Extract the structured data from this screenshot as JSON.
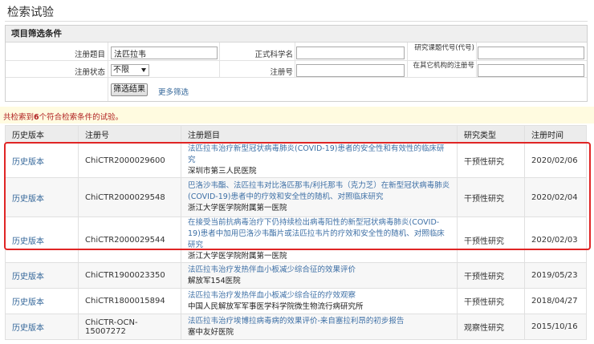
{
  "page": {
    "title": "检索试验"
  },
  "filter": {
    "header": "项目筛选条件",
    "reg_title_label": "注册题目",
    "reg_title_value": "法匹拉韦",
    "sci_name_label": "正式科学名",
    "sci_name_value": "",
    "topic_code_label": "研究课题代号(代号)",
    "topic_code_value": "",
    "status_label": "注册状态",
    "status_value": "不限",
    "reg_no_label": "注册号",
    "reg_no_value": "",
    "other_reg_label": "在其它机构的注册号",
    "other_reg_value": "",
    "submit_label": "筛选结果",
    "more_label": "更多筛选"
  },
  "results": {
    "prefix": "共检索到",
    "count": "6",
    "suffix": "个符合检索条件的试验。"
  },
  "table": {
    "headers": {
      "history": "历史版本",
      "reg_no": "注册号",
      "title": "注册题目",
      "type": "研究类型",
      "time": "注册时间"
    },
    "rows": [
      {
        "history": "历史版本",
        "reg_no": "ChiCTR2000029600",
        "title": "法匹拉韦治疗新型冠状病毒肺炎(COVID-19)患者的安全性和有效性的临床研究",
        "inst": "深圳市第三人民医院",
        "type": "干预性研究",
        "date": "2020/02/06"
      },
      {
        "history": "历史版本",
        "reg_no": "ChiCTR2000029548",
        "title": "巴洛沙韦酯、法匹拉韦对比洛匹那韦/利托那韦（克力芝）在新型冠状病毒肺炎(COVID-19)患者中的疗效和安全性的随机、对照临床研究",
        "inst": "浙江大学医学院附属第一医院",
        "type": "干预性研究",
        "date": "2020/02/04"
      },
      {
        "history": "历史版本",
        "reg_no": "ChiCTR2000029544",
        "title": "在接受当前抗病毒治疗下仍持续检出病毒阳性的新型冠状病毒肺炎(COVID-19)患者中加用巴洛沙韦酯片或法匹拉韦片的疗效和安全性的随机、对照临床研究",
        "inst": "浙江大学医学院附属第一医院",
        "type": "干预性研究",
        "date": "2020/02/03"
      },
      {
        "history": "历史版本",
        "reg_no": "ChiCTR1900023350",
        "title": "法匹拉韦治疗发热伴血小板减少综合征的效果评价",
        "inst": "解放军154医院",
        "type": "干预性研究",
        "date": "2019/05/23"
      },
      {
        "history": "历史版本",
        "reg_no": "ChiCTR1800015894",
        "title": "法匹拉韦治疗发热伴血小板减少综合征的疗效观察",
        "inst": "中国人民解放军军事医学科学院微生物流行病研究所",
        "type": "干预性研究",
        "date": "2018/04/27"
      },
      {
        "history": "历史版本",
        "reg_no": "ChiCTR-OCN-15007272",
        "title": "法匹拉韦治疗埃博拉病毒病的效果评价-来自塞拉利昂的初步报告",
        "inst": "塞中友好医院",
        "type": "观察性研究",
        "date": "2015/10/16"
      }
    ]
  },
  "colors": {
    "highlight": "#e02525",
    "link": "#336699",
    "banner": "#fffbe0",
    "count": "#b02020"
  }
}
